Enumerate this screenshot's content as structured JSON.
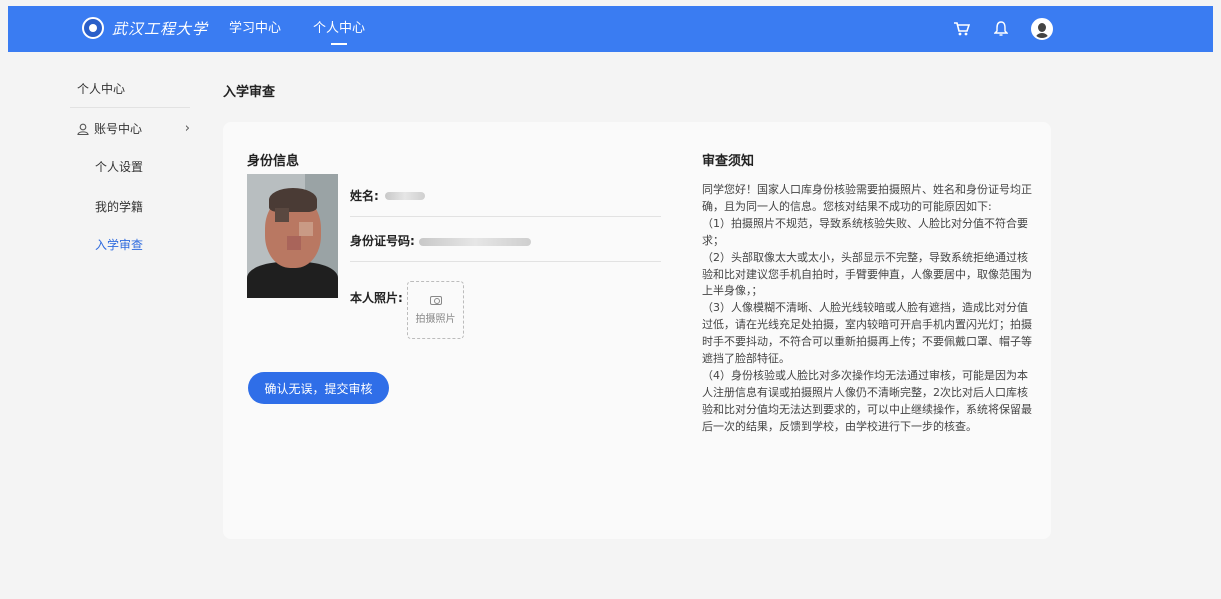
{
  "header": {
    "logo_text": "武汉工程大学",
    "nav": [
      "学习中心",
      "个人中心"
    ],
    "active_nav": "个人中心",
    "icons": [
      "cart-icon",
      "bell-icon",
      "user-avatar"
    ]
  },
  "sidebar": {
    "title": "个人中心",
    "group_label": "账号中心",
    "items": [
      "个人设置",
      "我的学籍",
      "入学审查"
    ],
    "active_item": "入学审查"
  },
  "page": {
    "title": "入学审查"
  },
  "identity": {
    "section_title": "身份信息",
    "name_label": "姓名:",
    "id_label": "身份证号码:",
    "photo_label": "本人照片:",
    "upload_label": "拍摄照片",
    "submit_label": "确认无误，提交审核"
  },
  "notice": {
    "title": "审查须知",
    "paragraphs": [
      "同学您好！国家人口库身份核验需要拍摄照片、姓名和身份证号均正确，且为同一人的信息。您核对结果不成功的可能原因如下:",
      "（1）拍摄照片不规范，导致系统核验失败、人脸比对分值不符合要求；",
      "（2）头部取像太大或太小，头部显示不完整，导致系统拒绝通过核验和比对建议您手机自拍时，手臂要伸直，人像要居中，取像范围为上半身像，；",
      "（3）人像模糊不清晰、人脸光线较暗或人脸有遮挡，造成比对分值过低，请在光线充足处拍摄，室内较暗可开启手机内置闪光灯；拍摄时手不要抖动，不符合可以重新拍摄再上传；不要佩戴口罩、帽子等遮挡了脸部特征。",
      "（4）身份核验或人脸比对多次操作均无法通过审核，可能是因为本人注册信息有误或拍摄照片人像仍不清晰完整，2次比对后人口库核验和比对分值均无法达到要求的，可以中止继续操作，系统将保留最后一次的结果，反馈到学校，由学校进行下一步的核查。"
    ]
  },
  "colors": {
    "header_bg": "#3a7cf2",
    "accent": "#2f6ee8",
    "active_text": "#2f6bde"
  }
}
